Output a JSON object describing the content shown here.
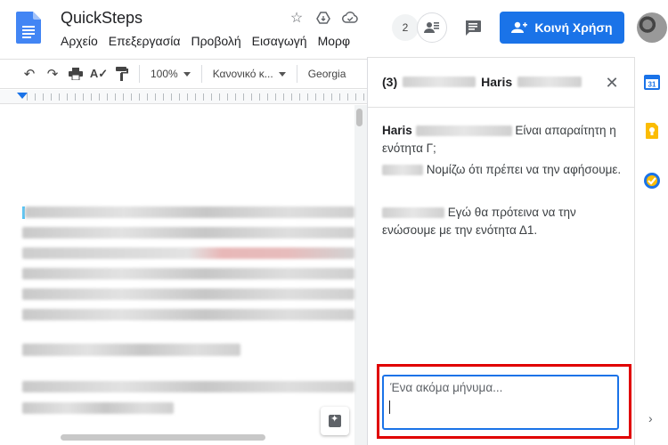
{
  "header": {
    "doc_title": "QuickSteps",
    "menu": [
      "Αρχείο",
      "Επεξεργασία",
      "Προβολή",
      "Εισαγωγή",
      "Μορφ"
    ],
    "presence_count": "2",
    "share_label": "Κοινή Χρήση"
  },
  "toolbar": {
    "zoom": "100%",
    "style": "Κανονικό κ...",
    "font": "Georgia"
  },
  "panel": {
    "count": "(3)",
    "name": "Haris",
    "messages": [
      {
        "author": "Haris",
        "text": "Είναι απαραίτητη η ενότητα Γ;"
      },
      {
        "author": "",
        "text": "Νομίζω ότι πρέπει να την αφήσουμε."
      },
      {
        "author": "",
        "text": "Εγώ θα πρότεινα να την ενώσουμε με την ενότητα Δ1."
      }
    ],
    "reply_placeholder": "Ένα ακόμα μήνυμα..."
  },
  "colors": {
    "accent": "#1a73e8",
    "highlight": "#e00000"
  }
}
